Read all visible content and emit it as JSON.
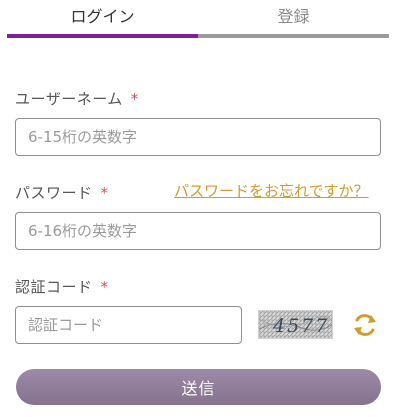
{
  "tabs": {
    "login_label": "ログイン",
    "register_label": "登録",
    "active_color": "#7b1fa2",
    "inactive_color": "#9b9b9b"
  },
  "username": {
    "label": "ユーザーネーム",
    "required_mark": "*",
    "placeholder": "6-15桁の英数字",
    "value": ""
  },
  "password": {
    "label": "パスワード",
    "required_mark": "*",
    "placeholder": "6-16桁の英数字",
    "value": "",
    "forgot_link": "パスワードをお忘れですか？"
  },
  "captcha": {
    "label": "認証コード",
    "required_mark": "*",
    "placeholder": "認証コード",
    "value": "",
    "image_text": "4577",
    "refresh_icon": "refresh-icon"
  },
  "submit": {
    "label": "送信"
  },
  "colors": {
    "link": "#d39a2e",
    "required": "#d9534f",
    "submit_bg": "#8f7b99"
  }
}
